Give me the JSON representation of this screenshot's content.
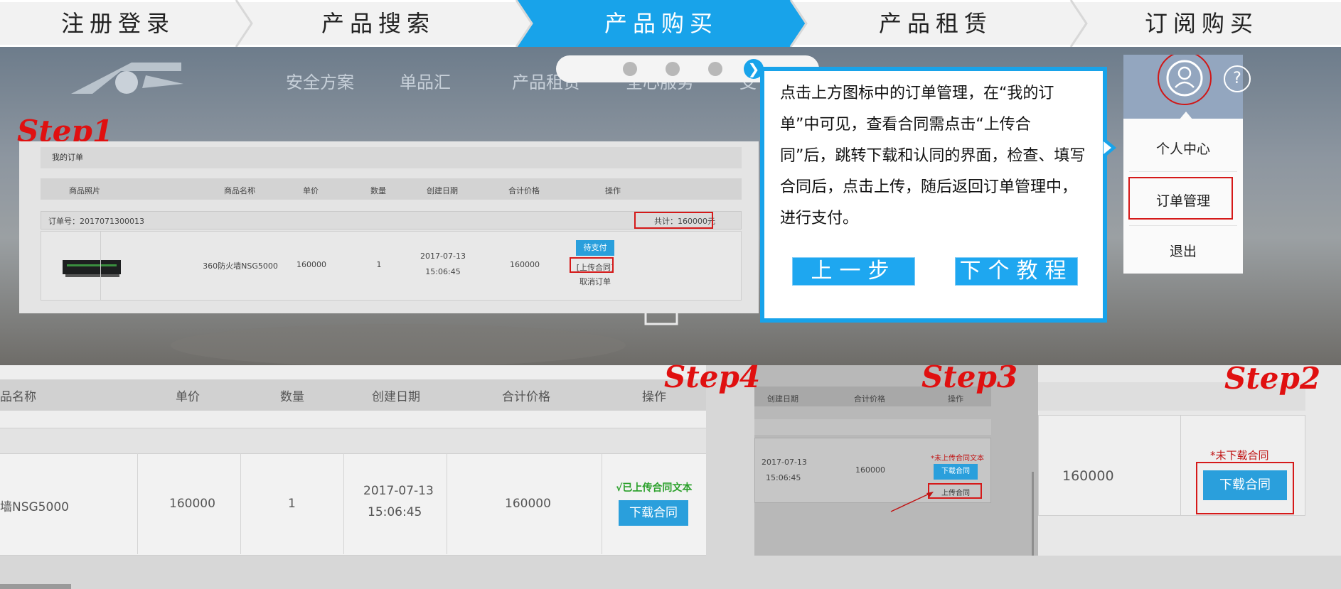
{
  "steps": [
    {
      "label": "注册登录"
    },
    {
      "label": "产品搜索"
    },
    {
      "label": "产品购买"
    },
    {
      "label": "产品租赁"
    },
    {
      "label": "订阅购买"
    }
  ],
  "colors": {
    "accent": "#18a3ea",
    "step_red": "#e01010",
    "highlight_red": "#d51919"
  },
  "nav": [
    "安全方案",
    "单品汇",
    "产品租赁",
    "全心服务",
    "支"
  ],
  "pager": {
    "next_glyph": "❯"
  },
  "step_tags": {
    "s1": "Step1",
    "s2": "Step2",
    "s3": "Step3",
    "s4": "Step4"
  },
  "orders": {
    "title": "我的订单",
    "columns": [
      "商品照片",
      "商品名称",
      "单价",
      "数量",
      "创建日期",
      "合计价格",
      "操作"
    ],
    "order_no": "订单号：2017071300013",
    "total": "共计：160000元",
    "row": {
      "name": "360防火墙NSG5000",
      "price": "160000",
      "qty": "1",
      "date": "2017-07-13",
      "time": "15:06:45",
      "total": "160000"
    },
    "pay_label": "待支付",
    "upload_label": "[上传合同]",
    "cancel_label": "取消订单"
  },
  "callout": {
    "text": "点击上方图标中的订单管理，在“我的订单”中可见，查看合同需点击“上传合同”后，跳转下载和认同的界面，检查、填写合同后，点击上传，随后返回订单管理中，进行支付。",
    "prev_label": "上一步",
    "next_label": "下个教程"
  },
  "user_menu": {
    "help_icon": "?",
    "items": [
      "个人中心",
      "订单管理",
      "退出"
    ]
  },
  "step4": {
    "columns": [
      "品名称",
      "单价",
      "数量",
      "创建日期",
      "合计价格",
      "操作"
    ],
    "name": "墙NSG5000",
    "price": "160000",
    "qty": "1",
    "date": "2017-07-13",
    "time": "15:06:45",
    "total": "160000",
    "status": "√已上传合同文本",
    "download_label": "下载合同"
  },
  "step3": {
    "columns": [
      "创建日期",
      "合计价格",
      "操作"
    ],
    "date": "2017-07-13",
    "time": "15:06:45",
    "total": "160000",
    "status": "*未上传合同文本",
    "download_label": "下载合同",
    "upload_label": "上传合同"
  },
  "step2": {
    "total": "160000",
    "status": "*未下载合同",
    "download_label": "下载合同"
  }
}
